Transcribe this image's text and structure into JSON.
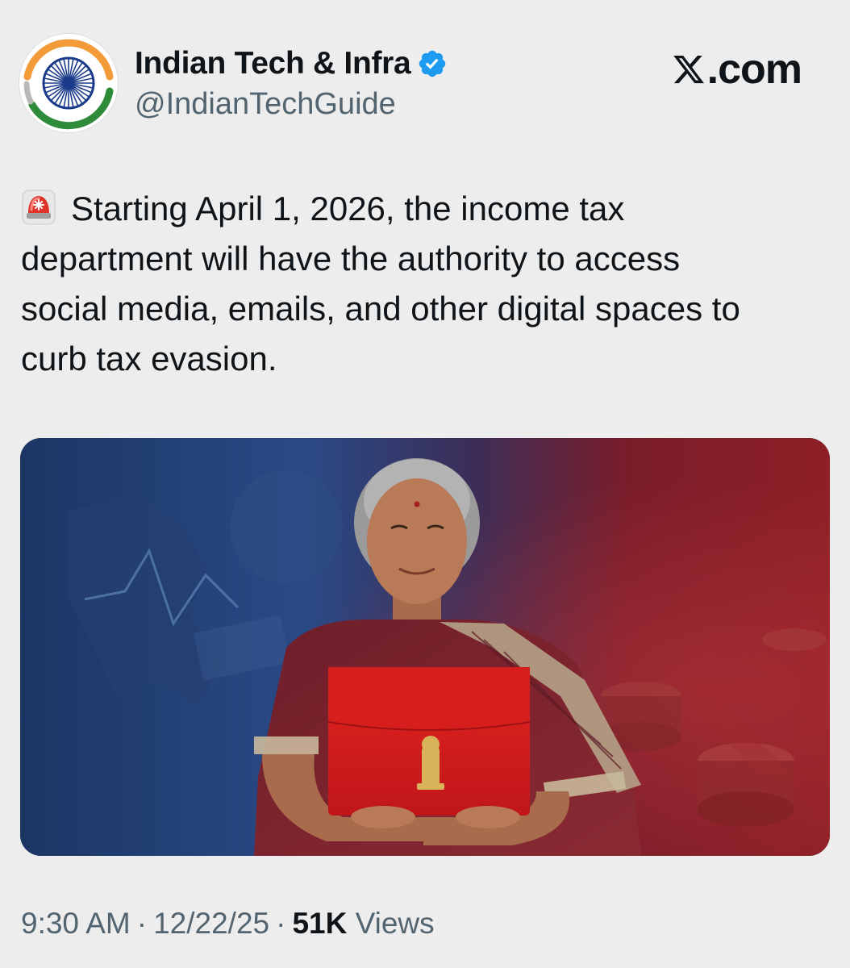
{
  "author": {
    "display_name": "Indian Tech & Infra",
    "handle": "@IndianTechGuide",
    "verified": true,
    "avatar_icon": "ashoka-chakra-icon"
  },
  "site": {
    "label": ".com",
    "logo_icon": "x-logo-icon"
  },
  "tweet": {
    "leading_icon": "police-siren-icon",
    "text": "Starting April 1, 2026, the income tax\ndepartment will have the authority to access\nsocial media, emails, and other digital spaces to\ncurb tax evasion."
  },
  "media": {
    "type": "photo",
    "icon": "budget-briefcase-photo"
  },
  "meta": {
    "time": "9:30 AM",
    "separator": "·",
    "date": "12/22/25",
    "views_count": "51K",
    "views_label": "Views"
  },
  "colors": {
    "background": "#ededed",
    "text_primary": "#0f1419",
    "text_secondary": "#536471",
    "verified_blue": "#1d9bf0",
    "saffron": "#f29b38",
    "india_green": "#2e8b3a",
    "chakra_navy": "#1a3a8a"
  }
}
